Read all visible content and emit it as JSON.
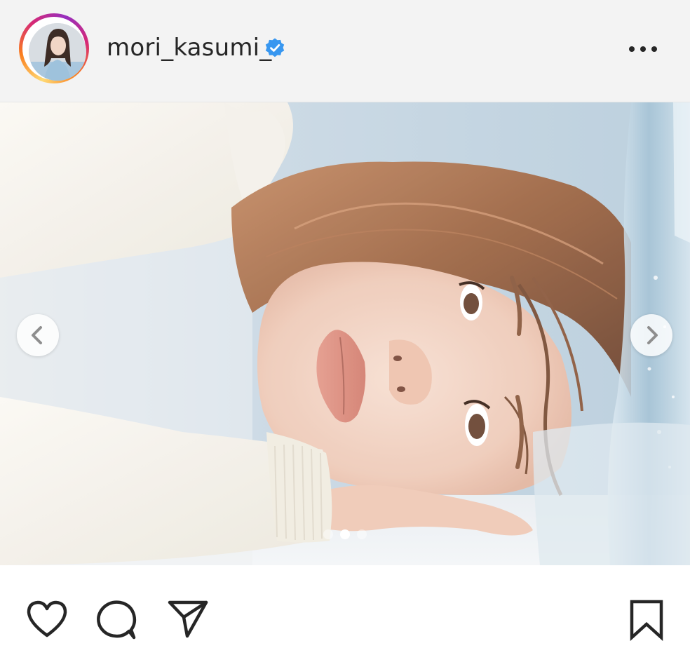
{
  "post": {
    "username": "mori_kasumi_",
    "verified": true,
    "avatar": "profile-photo",
    "menu_icon": "more-horizontal-icon"
  },
  "carousel": {
    "slide_count": 3,
    "active_index": 1,
    "prev_icon": "chevron-left-icon",
    "next_icon": "chevron-right-icon"
  },
  "actions": {
    "like_icon": "heart-icon",
    "comment_icon": "comment-bubble-icon",
    "share_icon": "paper-plane-icon",
    "save_icon": "bookmark-icon"
  },
  "colors": {
    "verified_badge": "#3897f0",
    "icon_stroke": "#262626",
    "header_bg": "#f3f3f3"
  }
}
